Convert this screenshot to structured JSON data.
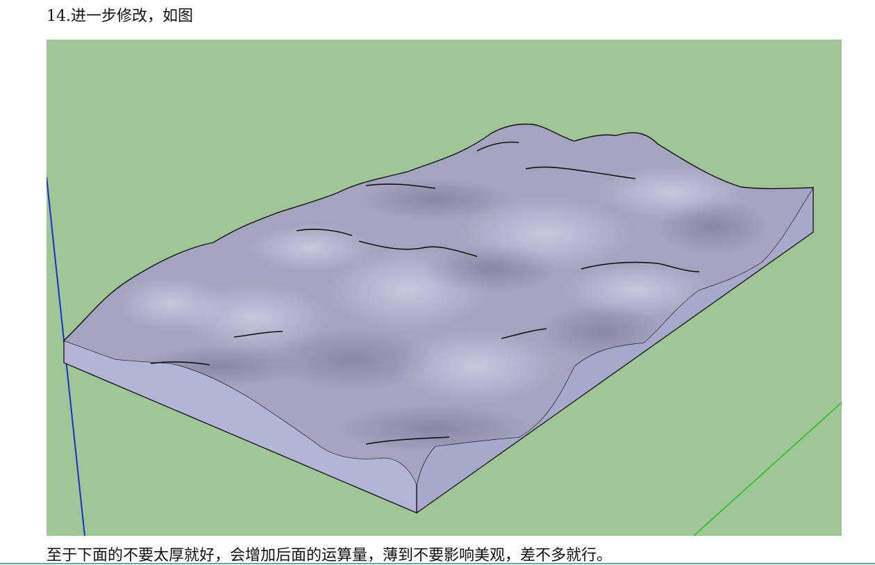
{
  "document": {
    "heading": "14.进一步修改，如图",
    "caption": "至于下面的不要太厚就好，会增加后面的运算量，薄到不要影响美观，差不多就行。"
  },
  "figure": {
    "background_color": "#a0c596",
    "terrain_top_color": "#a3a5be",
    "terrain_side_color": "#aeb0d0",
    "axis_colors": {
      "blue_axis": "#1a2fd0",
      "green_axis": "#20c020"
    }
  }
}
